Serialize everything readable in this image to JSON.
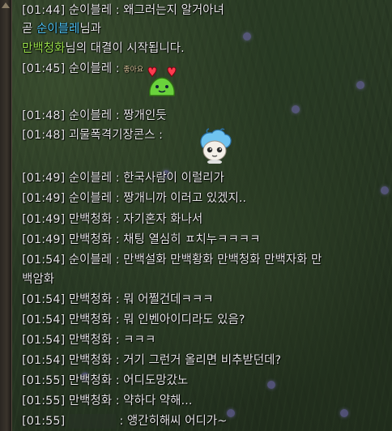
{
  "lines": [
    {
      "t": "[01:44] 순이블레 : 왜그러는지 알거아녀"
    },
    {
      "pre": "곧 ",
      "name": "순이블레",
      "post": "님과"
    },
    {
      "name": "만백청화",
      "post": "님의 대결이 시작됩니다."
    },
    {
      "t": "[01:45] 순이블레 : "
    },
    {
      "t": "[01:48] 순이블레 : 짱개인듯"
    },
    {
      "t": "[01:48] 괴물폭격기장콘스 :"
    },
    {
      "t": "[01:49] 순이블레 : 한국사람이 이럴리가"
    },
    {
      "t": "[01:49] 순이블레 : 짱개니까 이러고 있겠지.."
    },
    {
      "t": "[01:49] 만백청화 : 자기혼자 화나서"
    },
    {
      "t": "[01:49] 만백청화 : 채팅 열심히 ㅍ치누ㅋㅋㅋㅋ"
    },
    {
      "t": "[01:54] 순이블레 : 만백설화 만백황화 만백청화 만백자화 만"
    },
    {
      "t": "백암화"
    },
    {
      "t": "[01:54] 만백청화 : 뭐 어쩔건데ㅋㅋㅋ"
    },
    {
      "t": "[01:54] 만백청화 : 뭐 인벤아이디라도 있음?"
    },
    {
      "t": "[01:54] 만백청화 : ㅋㅋㅋ"
    },
    {
      "t": "[01:54] 만백청화 : 거기 그런거 올리면 비추받던데?"
    },
    {
      "t": "[01:55] 만백청화 : 어디도망갔노"
    },
    {
      "t": "[01:55] 만백청화 : 약하다 약해..."
    },
    {
      "pre": "[01:55] ",
      "post": " : 앵간히해씨 어디가~"
    }
  ],
  "emote1_caption": "좋아요",
  "colors": {
    "system_name": "#4cc0f2",
    "opponent_name": "#9be24c",
    "text": "#e6e6e6"
  },
  "icons": [
    "heart-frog-emote",
    "blue-haired-character-emote"
  ]
}
